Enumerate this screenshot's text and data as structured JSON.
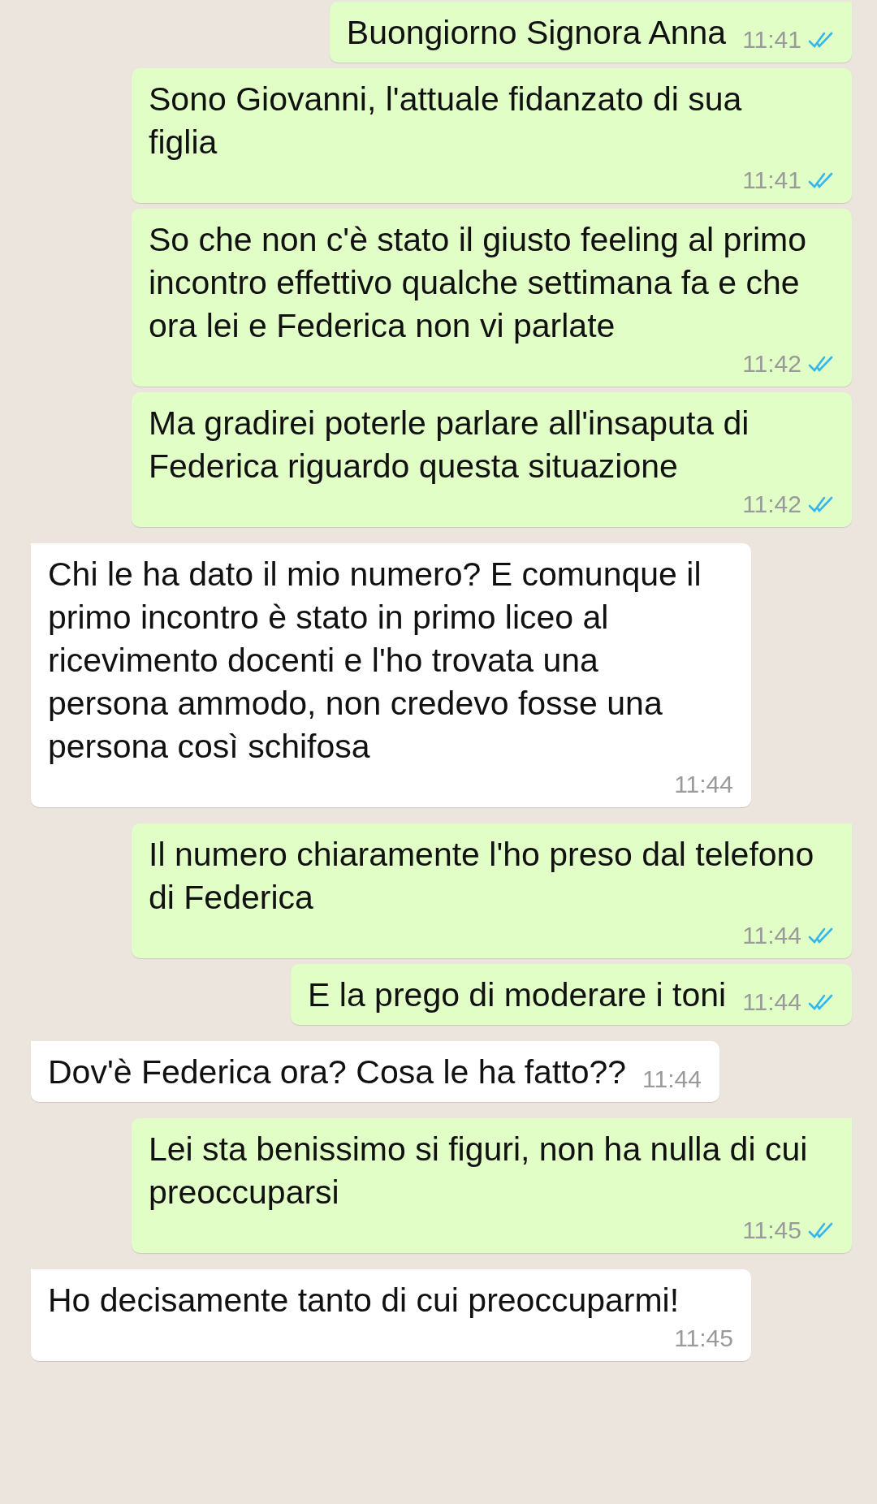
{
  "messages": [
    {
      "kind": "outgoing",
      "text": "Buongiorno Signora Anna",
      "time": "11:41",
      "read": true,
      "first": true
    },
    {
      "kind": "outgoing",
      "text": "Sono Giovanni, l'attuale fidanzato di sua figlia",
      "time": "11:41",
      "read": true,
      "first": false
    },
    {
      "kind": "outgoing",
      "text": "So che non c'è stato il giusto feeling al primo incontro effettivo qualche settimana fa e che ora lei e Federica non vi parlate",
      "time": "11:42",
      "read": true,
      "first": false
    },
    {
      "kind": "outgoing",
      "text": "Ma gradirei poterle parlare all'insaputa di Federica riguardo questa situazione",
      "time": "11:42",
      "read": true,
      "first": false
    },
    {
      "kind": "incoming",
      "text": "Chi le ha dato il mio numero? E comunque il primo incontro è stato in primo liceo al ricevimento docenti e l'ho trovata una persona ammodo, non credevo fosse una persona così schifosa",
      "time": "11:44",
      "first": true
    },
    {
      "kind": "outgoing",
      "text": "Il numero chiaramente l'ho preso dal telefono di Federica",
      "time": "11:44",
      "read": true,
      "first": true
    },
    {
      "kind": "outgoing",
      "text": "E la prego di moderare i toni",
      "time": "11:44",
      "read": true,
      "first": false
    },
    {
      "kind": "incoming",
      "text": "Dov'è Federica ora? Cosa le ha fatto??",
      "time": "11:44",
      "first": true
    },
    {
      "kind": "outgoing",
      "text": "Lei sta benissimo si figuri, non ha nulla di cui preoccuparsi",
      "time": "11:45",
      "read": true,
      "first": true
    },
    {
      "kind": "incoming",
      "text": "Ho decisamente tanto di cui preoccuparmi!",
      "time": "11:45",
      "first": true
    }
  ]
}
